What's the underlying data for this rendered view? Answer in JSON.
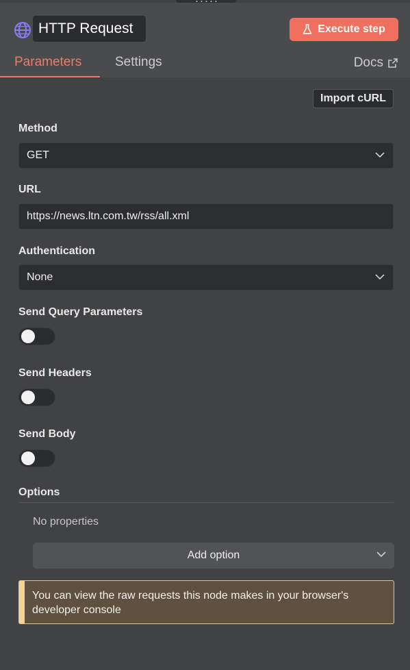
{
  "header": {
    "title": "HTTP Request",
    "execute_label": "Execute step",
    "tabs": [
      {
        "label": "Parameters",
        "active": true
      },
      {
        "label": "Settings",
        "active": false
      }
    ],
    "docs_label": "Docs"
  },
  "import_curl_label": "Import cURL",
  "method": {
    "label": "Method",
    "value": "GET"
  },
  "url": {
    "label": "URL",
    "value": "https://news.ltn.com.tw/rss/all.xml"
  },
  "authentication": {
    "label": "Authentication",
    "value": "None"
  },
  "toggles": [
    {
      "label": "Send Query Parameters",
      "on": false
    },
    {
      "label": "Send Headers",
      "on": false
    },
    {
      "label": "Send Body",
      "on": false
    }
  ],
  "options": {
    "label": "Options",
    "empty_text": "No properties",
    "add_label": "Add option"
  },
  "notice": {
    "text": "You can view the raw requests this node makes in your browser's developer console"
  },
  "colors": {
    "accent": "#f06f5f",
    "background": "#414244",
    "notice_bg": "#5f5140",
    "globe": "#8a7cf0"
  }
}
